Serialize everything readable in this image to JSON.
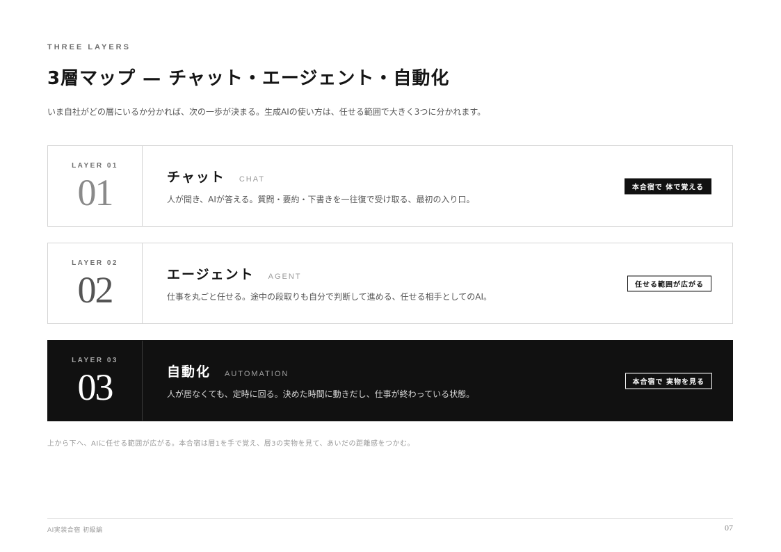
{
  "header": {
    "eyebrow": "THREE LAYERS",
    "title": "3層マップ — チャット・エージェント・自動化",
    "lead": "いま自社がどの層にいるか分かれば、次の一歩が決まる。生成AIの使い方は、任せる範囲で大きく3つに分かれます。"
  },
  "layers": [
    {
      "tag": "LAYER 01",
      "number": "01",
      "name": "チャット",
      "en": "CHAT",
      "desc": "人が聞き、AIが答える。質問・要約・下書きを一往復で受け取る、最初の入り口。",
      "badge": "本合宿で 体で覚える"
    },
    {
      "tag": "LAYER 02",
      "number": "02",
      "name": "エージェント",
      "en": "AGENT",
      "desc": "仕事を丸ごと任せる。途中の段取りも自分で判断して進める、任せる相手としてのAI。",
      "badge": "任せる範囲が広がる"
    },
    {
      "tag": "LAYER 03",
      "number": "03",
      "name": "自動化",
      "en": "AUTOMATION",
      "desc": "人が居なくても、定時に回る。決めた時間に動きだし、仕事が終わっている状態。",
      "badge": "本合宿で 実物を見る"
    }
  ],
  "note": "上から下へ、AIに任せる範囲が広がる。本合宿は層1を手で覚え、層3の実物を見て、あいだの距離感をつかむ。",
  "footer": {
    "left": "AI実装合宿 初級編",
    "page": "07"
  },
  "colors": {
    "ink": "#111111",
    "muted": "#555555",
    "rule": "#d4d4d4"
  }
}
